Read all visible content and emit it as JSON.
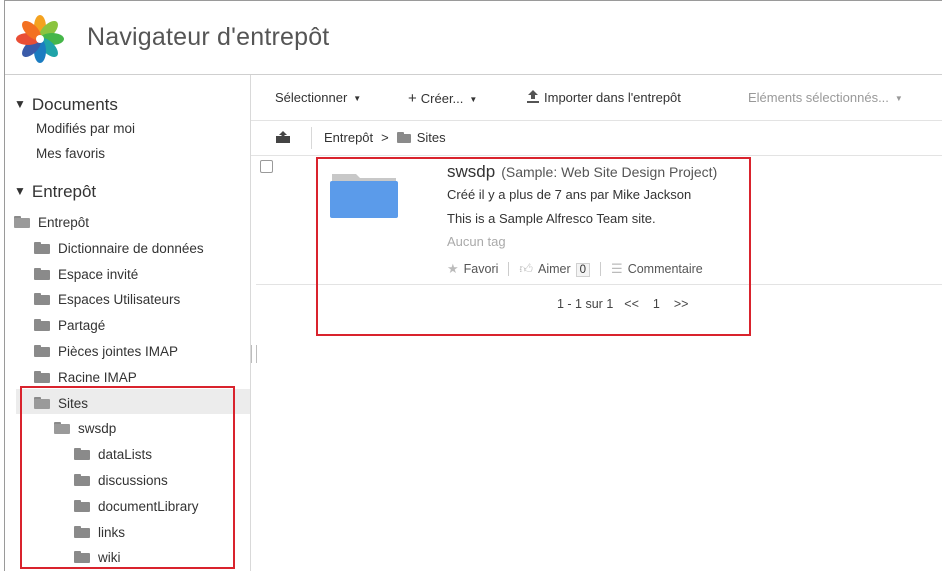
{
  "header": {
    "title": "Navigateur d'entrepôt",
    "logo_icon": "alfresco-flower-icon"
  },
  "left": {
    "documents": {
      "heading": "Documents",
      "links": [
        "Modifiés par moi",
        "Mes favoris"
      ]
    },
    "repository": {
      "heading": "Entrepôt",
      "tree": [
        {
          "label": "Entrepôt",
          "level": 0,
          "icon": "folder-icon"
        },
        {
          "label": "Dictionnaire de données",
          "level": 1,
          "icon": "folder-icon"
        },
        {
          "label": "Espace invité",
          "level": 1,
          "icon": "folder-icon"
        },
        {
          "label": "Espaces Utilisateurs",
          "level": 1,
          "icon": "folder-icon"
        },
        {
          "label": "Partagé",
          "level": 1,
          "icon": "folder-icon"
        },
        {
          "label": "Pièces jointes IMAP",
          "level": 1,
          "icon": "folder-icon"
        },
        {
          "label": "Racine IMAP",
          "level": 1,
          "icon": "folder-icon"
        },
        {
          "label": "Sites",
          "level": 1,
          "icon": "folder-icon",
          "selected": true
        },
        {
          "label": "swsdp",
          "level": 2,
          "icon": "folder-icon"
        },
        {
          "label": "dataLists",
          "level": 3,
          "icon": "folder-icon"
        },
        {
          "label": "discussions",
          "level": 3,
          "icon": "folder-icon"
        },
        {
          "label": "documentLibrary",
          "level": 3,
          "icon": "folder-icon"
        },
        {
          "label": "links",
          "level": 3,
          "icon": "folder-icon"
        },
        {
          "label": "wiki",
          "level": 3,
          "icon": "folder-icon"
        }
      ]
    }
  },
  "toolbar": {
    "select": "Sélectionner",
    "create": "Créer...",
    "create_prefix": "+",
    "import": "Importer dans l'entrepôt",
    "selected_items": "Eléments sélectionnés..."
  },
  "breadcrumb": {
    "root": "Entrepôt",
    "separator": ">",
    "current": "Sites"
  },
  "item": {
    "name": "swsdp",
    "subtitle": "(Sample: Web Site Design Project)",
    "created": "Créé il y a plus de 7 ans par Mike Jackson",
    "description": "This is a Sample Alfresco Team site.",
    "tags": "Aucun tag",
    "favorite": "Favori",
    "like": "Aimer",
    "like_count": "0",
    "comment": "Commentaire"
  },
  "pager": {
    "range": "1 - 1 sur 1",
    "prev": "<<",
    "page": "1",
    "next": ">>"
  },
  "colors": {
    "highlight": "#d9232d",
    "folder_blue": "#5b9bea",
    "folder_gray": "#8a8a8a"
  }
}
